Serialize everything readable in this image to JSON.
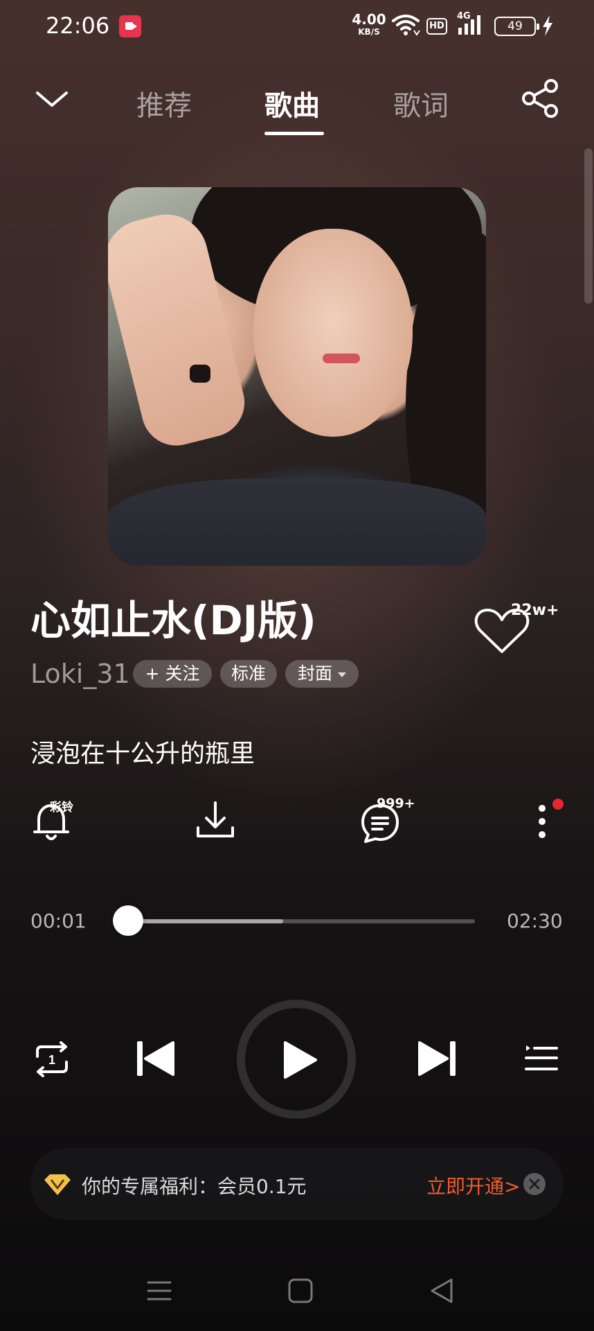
{
  "status_bar": {
    "time": "22:06",
    "net_speed_value": "4.00",
    "net_speed_unit": "KB/S",
    "hd_label": "HD",
    "network_label": "4G",
    "battery_level": "49"
  },
  "header": {
    "tabs": [
      {
        "label": "推荐",
        "active": false
      },
      {
        "label": "歌曲",
        "active": true
      },
      {
        "label": "歌词",
        "active": false
      }
    ]
  },
  "song": {
    "title": "心如止水(DJ版)",
    "artist": "Loki_31",
    "follow_label": "+ 关注",
    "quality_label": "标准",
    "cover_label": "封面",
    "like_count": "22w+",
    "current_lyric": "浸泡在十公升的瓶里"
  },
  "actions": {
    "ringtone_badge": "彩铃",
    "comment_count": "999+"
  },
  "player": {
    "elapsed": "00:01",
    "duration": "02:30",
    "progress_fraction": 0.0067,
    "buffered_fraction": 0.45
  },
  "promo": {
    "text": "你的专属福利：会员0.1元",
    "cta": "立即开通>"
  },
  "colors": {
    "accent_red": "#e5262f",
    "cta_orange": "#ef5b2c",
    "vip_gold": "#f2c14e"
  }
}
